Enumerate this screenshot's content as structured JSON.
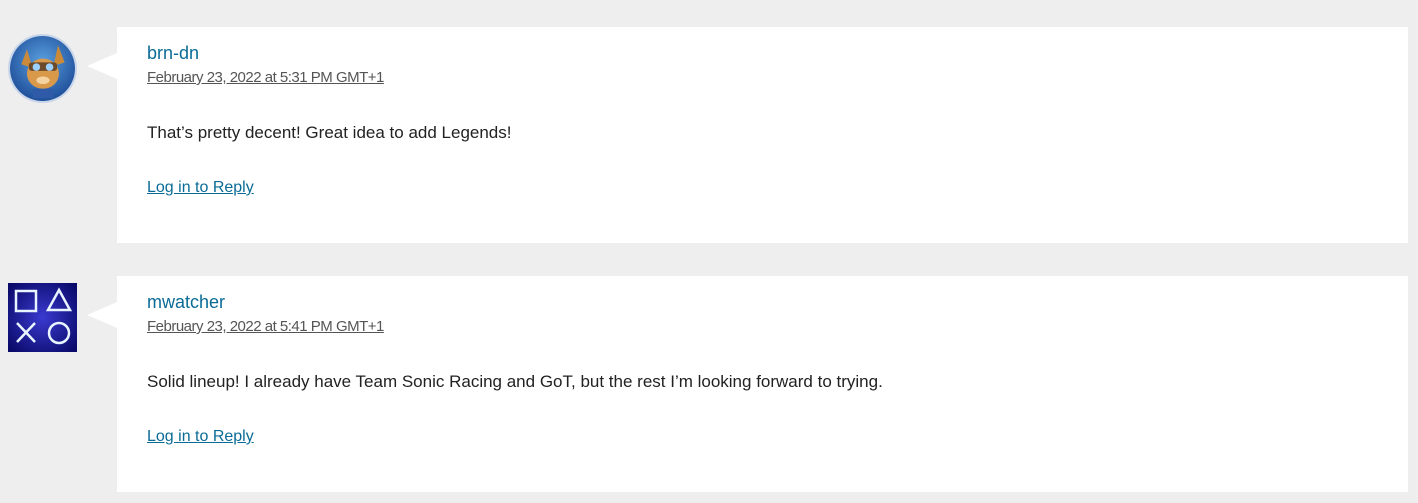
{
  "comments": [
    {
      "author": "brn-dn",
      "date": "February 23, 2022 at 5:31 PM GMT+1",
      "text": "That’s pretty decent! Great idea to add Legends!",
      "reply_label": "Log in to Reply",
      "avatar_icon": "ratchet-character-avatar"
    },
    {
      "author": "mwatcher",
      "date": "February 23, 2022 at 5:41 PM GMT+1",
      "text": "Solid lineup! I already have Team Sonic Racing and GoT, but the rest I’m looking forward to trying.",
      "reply_label": "Log in to Reply",
      "avatar_icon": "playstation-symbols-avatar"
    }
  ],
  "colors": {
    "background": "#eeeeee",
    "card": "#ffffff",
    "link": "#0a6b96",
    "text": "#222222",
    "date": "#555555"
  }
}
